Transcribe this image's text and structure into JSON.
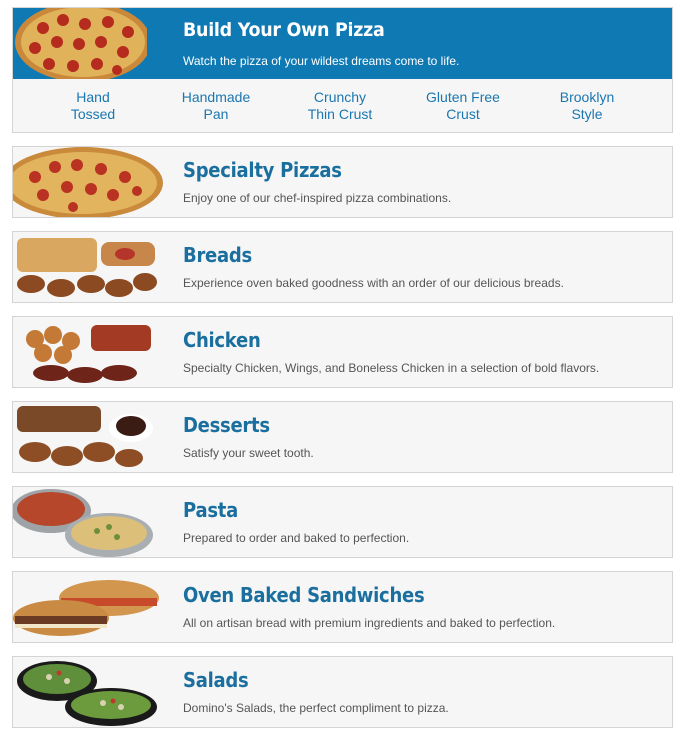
{
  "build_your_own": {
    "title": "Build Your Own Pizza",
    "subtitle": "Watch the pizza of your wildest dreams come to life.",
    "image": "pizza-image",
    "crusts": [
      {
        "line1": "Hand",
        "line2": "Tossed"
      },
      {
        "line1": "Handmade",
        "line2": "Pan"
      },
      {
        "line1": "Crunchy",
        "line2": "Thin Crust"
      },
      {
        "line1": "Gluten Free",
        "line2": "Crust"
      },
      {
        "line1": "Brooklyn",
        "line2": "Style"
      }
    ]
  },
  "categories": [
    {
      "title": "Specialty Pizzas",
      "description": "Enjoy one of our chef-inspired pizza combinations.",
      "image": "specialty-pizza-image"
    },
    {
      "title": "Breads",
      "description": "Experience oven baked goodness with an order of our delicious breads.",
      "image": "breads-image"
    },
    {
      "title": "Chicken",
      "description": "Specialty Chicken, Wings, and Boneless Chicken in a selection of bold flavors.",
      "image": "chicken-image"
    },
    {
      "title": "Desserts",
      "description": "Satisfy your sweet tooth.",
      "image": "desserts-image"
    },
    {
      "title": "Pasta",
      "description": "Prepared to order and baked to perfection.",
      "image": "pasta-image"
    },
    {
      "title": "Oven Baked Sandwiches",
      "description": "All on artisan bread with premium ingredients and baked to perfection.",
      "image": "sandwiches-image"
    },
    {
      "title": "Salads",
      "description": "Domino's Salads, the perfect compliment to pizza.",
      "image": "salads-image"
    }
  ],
  "colors": {
    "header_blue": "#0f79b4",
    "link_blue": "#1b77b1",
    "title_blue": "#1a6f9f",
    "card_bg": "#f6f6f6",
    "border": "#d4d4d4",
    "desc_gray": "#555555"
  }
}
